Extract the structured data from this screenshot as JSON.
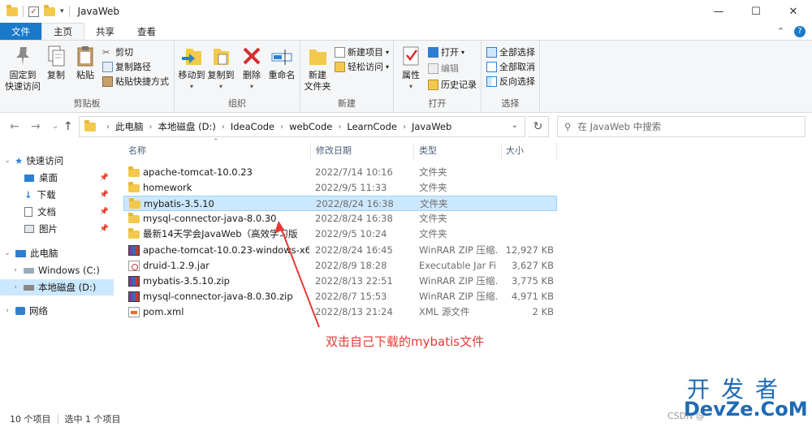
{
  "window": {
    "title": "JavaWeb",
    "controls": {
      "minimize": "—",
      "maximize": "☐",
      "close": "✕"
    }
  },
  "tabs": [
    {
      "label": "文件"
    },
    {
      "label": "主页"
    },
    {
      "label": "共享"
    },
    {
      "label": "查看"
    }
  ],
  "ribbon": {
    "clipboard": {
      "label": "剪贴板",
      "pin": "固定到\n快速访问",
      "copy": "复制",
      "paste": "粘贴",
      "cut": "剪切",
      "copy_path": "复制路径",
      "paste_shortcut": "粘贴快捷方式"
    },
    "organize": {
      "label": "组织",
      "move_to": "移动到",
      "copy_to": "复制到",
      "delete": "删除",
      "rename": "重命名"
    },
    "new": {
      "label": "新建",
      "new_folder": "新建\n文件夹",
      "new_item": "新建项目",
      "easy_access": "轻松访问"
    },
    "open": {
      "label": "打开",
      "properties": "属性",
      "open": "打开",
      "edit": "编辑",
      "history": "历史记录"
    },
    "select": {
      "label": "选择",
      "select_all": "全部选择",
      "select_none": "全部取消",
      "invert": "反向选择"
    }
  },
  "address": {
    "crumbs": [
      "此电脑",
      "本地磁盘 (D:)",
      "IdeaCode",
      "webCode",
      "LearnCode",
      "JavaWeb"
    ],
    "search_placeholder": "在 JavaWeb 中搜索"
  },
  "nav": {
    "quick_access": "快速访问",
    "desktop": "桌面",
    "downloads": "下载",
    "documents": "文档",
    "pictures": "图片",
    "this_pc": "此电脑",
    "windows_c": "Windows (C:)",
    "local_d": "本地磁盘 (D:)",
    "network": "网络"
  },
  "columns": {
    "name": "名称",
    "date": "修改日期",
    "type": "类型",
    "size": "大小"
  },
  "files": [
    {
      "name": "apache-tomcat-10.0.23",
      "date": "2022/7/14 10:16",
      "type": "文件夹",
      "size": "",
      "kind": "folder"
    },
    {
      "name": "homework",
      "date": "2022/9/5 11:33",
      "type": "文件夹",
      "size": "",
      "kind": "folder"
    },
    {
      "name": "mybatis-3.5.10",
      "date": "2022/8/24 16:38",
      "type": "文件夹",
      "size": "",
      "kind": "folder"
    },
    {
      "name": "mysql-connector-java-8.0.30",
      "date": "2022/8/24 16:38",
      "type": "文件夹",
      "size": "",
      "kind": "folder"
    },
    {
      "name": "最新14天学会JavaWeb（高效学习版",
      "date": "2022/9/5 10:24",
      "type": "文件夹",
      "size": "",
      "kind": "folder"
    },
    {
      "name": "apache-tomcat-10.0.23-windows-x6",
      "date": "2022/8/24 16:45",
      "type": "WinRAR ZIP 压缩...",
      "size": "12,927 KB",
      "kind": "zip"
    },
    {
      "name": "druid-1.2.9.jar",
      "date": "2022/8/9 18:28",
      "type": "Executable Jar File",
      "size": "3,627 KB",
      "kind": "jar"
    },
    {
      "name": "mybatis-3.5.10.zip",
      "date": "2022/8/13 22:51",
      "type": "WinRAR ZIP 压缩...",
      "size": "3,775 KB",
      "kind": "zip"
    },
    {
      "name": "mysql-connector-java-8.0.30.zip",
      "date": "2022/8/7 15:53",
      "type": "WinRAR ZIP 压缩...",
      "size": "4,971 KB",
      "kind": "zip"
    },
    {
      "name": "pom.xml",
      "date": "2022/8/13 21:24",
      "type": "XML 源文件",
      "size": "2 KB",
      "kind": "xml"
    }
  ],
  "annotation": "双击自己下载的mybatis文件",
  "status": {
    "count": "10 个项目",
    "selected": "选中 1 个项目"
  },
  "watermark": {
    "cn": "开发者",
    "en": "DevZe.CoM",
    "csdn": "CSDN @"
  }
}
